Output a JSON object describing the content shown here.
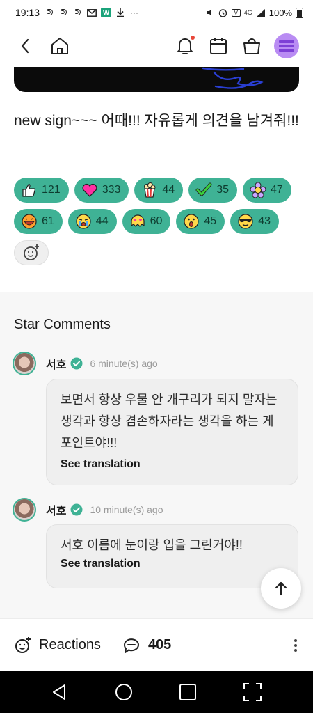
{
  "status_bar": {
    "time": "19:13",
    "left_icons": [
      "b-icon",
      "b-icon",
      "b-icon",
      "mail-icon",
      "w-icon",
      "download-icon",
      "more-icon"
    ],
    "w_label": "W",
    "right_small": "4G",
    "battery": "100%"
  },
  "nav": {
    "back": "back",
    "home": "home",
    "notifications": "notifications",
    "calendar": "calendar",
    "shop": "shop",
    "menu": "menu"
  },
  "post": {
    "text": "new sign~~~ 어때!!! 자유롭게 의견을 남겨줘!!!"
  },
  "reactions": [
    {
      "icon": "thumbs-up-icon",
      "count": "121"
    },
    {
      "icon": "heart-icon",
      "count": "333"
    },
    {
      "icon": "popcorn-icon",
      "count": "44"
    },
    {
      "icon": "check-icon",
      "count": "35"
    },
    {
      "icon": "flower-icon",
      "count": "47"
    },
    {
      "icon": "laughing-face-icon",
      "count": "61"
    },
    {
      "icon": "crying-face-icon",
      "count": "44"
    },
    {
      "icon": "heart-eyes-icon",
      "count": "60"
    },
    {
      "icon": "surprised-face-icon",
      "count": "45"
    },
    {
      "icon": "sunglasses-face-icon",
      "count": "43"
    }
  ],
  "section": {
    "title": "Star Comments"
  },
  "comments": [
    {
      "author": "서호",
      "time": "6 minute(s) ago",
      "text": "보면서 항상 우물 안 개구리가 되지 말자는 생각과 항상 겸손하자라는 생각을 하는 게 포인트야!!!",
      "translate": "See translation"
    },
    {
      "author": "서호",
      "time": "10 minute(s) ago",
      "text": "서호 이름에 눈이랑 입을 그린거야!!",
      "translate": "See translation"
    }
  ],
  "bottom_bar": {
    "reactions_label": "Reactions",
    "comment_count": "405"
  },
  "colors": {
    "accent": "#3fb295",
    "menu_purple": "#b98cf3",
    "notif_dot": "#e8473a"
  }
}
